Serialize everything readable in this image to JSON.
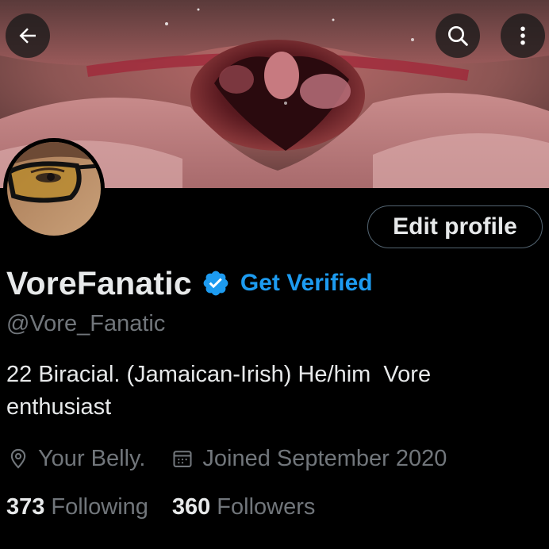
{
  "header": {
    "back_icon": "arrow-left-icon",
    "search_icon": "search-icon",
    "more_icon": "more-vertical-icon"
  },
  "profile": {
    "display_name": "VoreFanatic",
    "get_verified_label": "Get Verified",
    "handle": "@Vore_Fanatic",
    "bio": "22 Biracial. (Jamaican-Irish) He/him  Vore enthusiast",
    "location": "Your Belly.",
    "joined": "Joined September 2020",
    "edit_profile_label": "Edit profile"
  },
  "stats": {
    "following_count": "373",
    "following_label": "Following",
    "followers_count": "360",
    "followers_label": "Followers"
  },
  "colors": {
    "background": "#000000",
    "text_primary": "#e7e9ea",
    "text_secondary": "#71767b",
    "accent": "#1d9bf0",
    "button_border": "#536471"
  }
}
